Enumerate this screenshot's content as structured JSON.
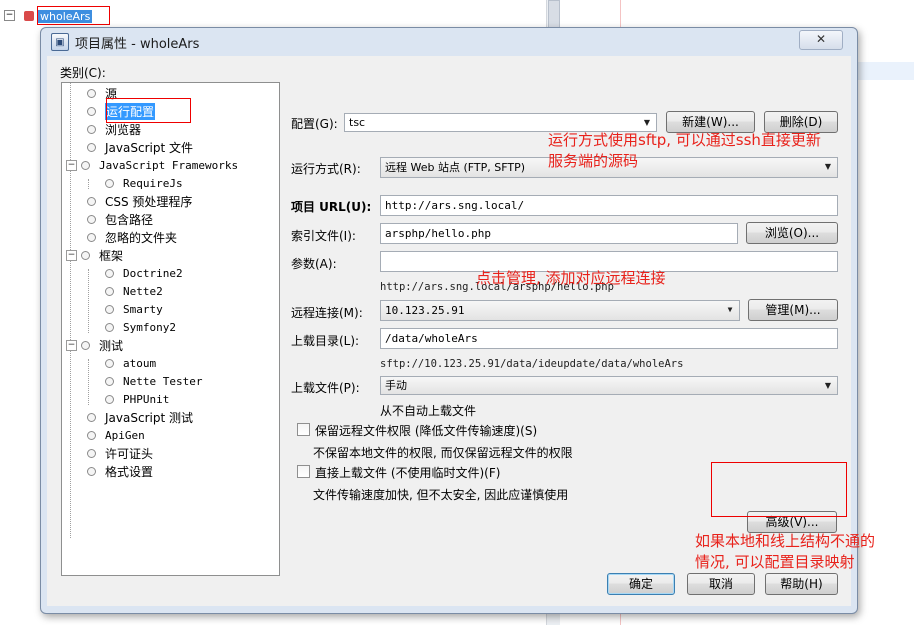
{
  "background": {
    "project_node": "wholeArs",
    "expander": "−"
  },
  "dialog": {
    "title": "项目属性 - wholeArs",
    "close": "✕"
  },
  "categories": {
    "label": "类别(C):",
    "items": [
      {
        "label": "源",
        "selected": false
      },
      {
        "label": "运行配置",
        "selected": true
      },
      {
        "label": "浏览器",
        "selected": false
      },
      {
        "label": "JavaScript 文件",
        "selected": false
      },
      {
        "label": "JavaScript Frameworks",
        "selected": false
      },
      {
        "label": "RequireJs",
        "selected": false
      },
      {
        "label": "CSS 预处理程序",
        "selected": false
      },
      {
        "label": "包含路径",
        "selected": false
      },
      {
        "label": "忽略的文件夹",
        "selected": false
      },
      {
        "label": "框架",
        "selected": false
      },
      {
        "label": "Doctrine2",
        "selected": false
      },
      {
        "label": "Nette2",
        "selected": false
      },
      {
        "label": "Smarty",
        "selected": false
      },
      {
        "label": "Symfony2",
        "selected": false
      },
      {
        "label": "测试",
        "selected": false
      },
      {
        "label": "atoum",
        "selected": false
      },
      {
        "label": "Nette Tester",
        "selected": false
      },
      {
        "label": "PHPUnit",
        "selected": false
      },
      {
        "label": "JavaScript 测试",
        "selected": false
      },
      {
        "label": "ApiGen",
        "selected": false
      },
      {
        "label": "许可证头",
        "selected": false
      },
      {
        "label": "格式设置",
        "selected": false
      }
    ],
    "expander": "−"
  },
  "form": {
    "config": {
      "label": "配置(G):",
      "value": "tsc"
    },
    "new_button": "新建(W)...",
    "delete_button": "删除(D)",
    "run_as": {
      "label": "运行方式(R):",
      "value": "远程 Web 站点 (FTP, SFTP)"
    },
    "project_url": {
      "label": "项目 URL(U):",
      "value": "http://ars.sng.local/"
    },
    "index_file": {
      "label": "索引文件(I):",
      "value": "arsphp/hello.php"
    },
    "browse_button": "浏览(O)...",
    "arguments": {
      "label": "参数(A):",
      "value": ""
    },
    "url_hint": "http://ars.sng.local/arsphp/hello.php",
    "remote_connection": {
      "label": "远程连接(M):",
      "value": "10.123.25.91"
    },
    "manage_button": "管理(M)...",
    "upload_dir": {
      "label": "上载目录(L):",
      "value": "/data/wholeArs"
    },
    "upload_hint": "sftp://10.123.25.91/data/ideupdate/data/wholeArs",
    "upload_files": {
      "label": "上载文件(P):",
      "value": "手动"
    },
    "upload_files_hint": "从不自动上载文件",
    "preserve_permissions": {
      "label": "保留远程文件权限 (降低文件传输速度)(S)",
      "hint": "不保留本地文件的权限, 而仅保留远程文件的权限",
      "checked": false
    },
    "direct_upload": {
      "label": "直接上载文件 (不使用临时文件)(F)",
      "hint": "文件传输速度加快, 但不太安全, 因此应谨慎使用",
      "checked": false
    },
    "advanced_button": "高级(V)..."
  },
  "buttons": {
    "ok": "确定",
    "cancel": "取消",
    "help": "帮助(H)"
  },
  "annotations": {
    "sftp_line1": "运行方式使用sftp, 可以通过ssh直接更新",
    "sftp_line2": "服务端的源码",
    "manage": "点击管理, 添加对应远程连接",
    "mapping_line1": "如果本地和线上结构不通的",
    "mapping_line2": "情况, 可以配置目录映射"
  },
  "colors": {
    "annotation": "#e8221b",
    "selection": "#3399ff",
    "dialog_frame": "#dbe5f2"
  }
}
